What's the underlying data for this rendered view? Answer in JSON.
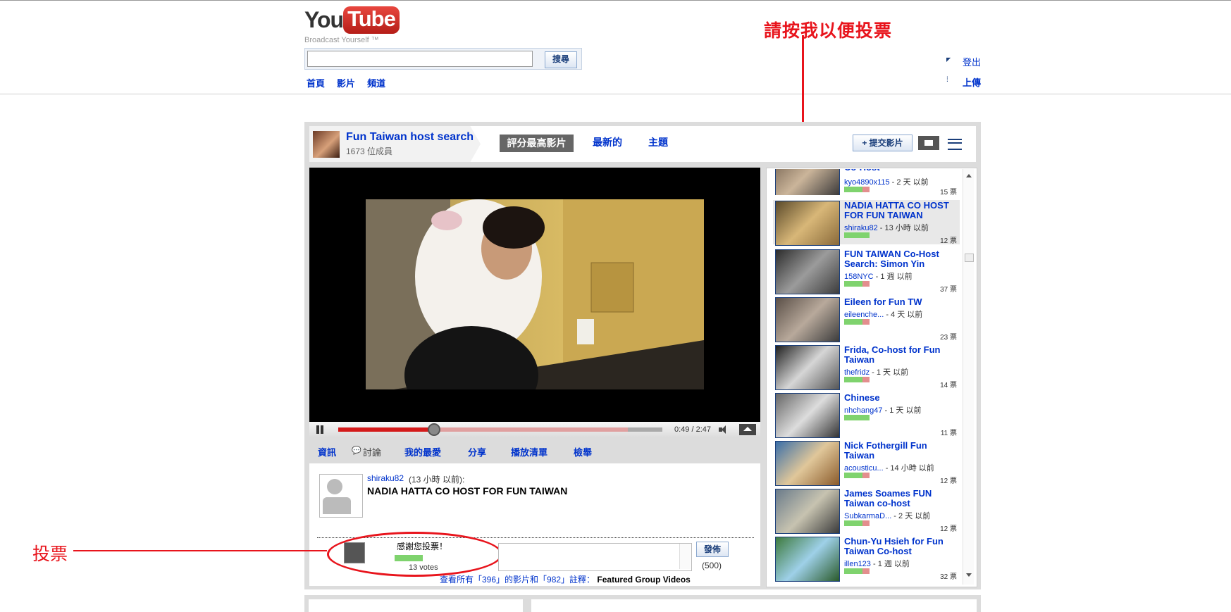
{
  "header": {
    "logo_you": "You",
    "logo_tube": "Tube",
    "tagline": "Broadcast Yourself ™",
    "search_placeholder": "",
    "search_button": "搜尋",
    "nav": [
      "首頁",
      "影片",
      "頻道"
    ],
    "signout": "登出",
    "upload": "上傳"
  },
  "annotations": {
    "vote_here": "請按我以便投票",
    "vote": "投票"
  },
  "group": {
    "title": "Fun Taiwan host search",
    "members": "1673 位成員",
    "tab_top_rated": "評分最高影片",
    "tab_newest": "最新的",
    "tab_topics": "主題",
    "submit_video": "+ 提交影片"
  },
  "player": {
    "time": "0:49 / 2:47",
    "progress_fraction": 0.293,
    "buffered_fraction": 0.894
  },
  "bottom_tabs": [
    "資訊",
    "討論",
    "我的最愛",
    "分享",
    "播放清單",
    "檢舉"
  ],
  "post": {
    "user": "shiraku82",
    "time": "(13 小時 以前):",
    "title": "NADIA HATTA CO HOST FOR FUN TAIWAN"
  },
  "vote_box": {
    "thanks": "感謝您投票！",
    "votes": "13 votes",
    "publish": "發佈",
    "char_limit": "(500)"
  },
  "view_all": {
    "text": "查看所有「396」的影片和「982」註釋：",
    "bold": "Featured Group Videos"
  },
  "sidebar_videos": [
    {
      "title": "Co-Host",
      "user": "kyo4890x115",
      "age": " - 2 天 以前",
      "votes": "15 票",
      "rating": 0.72
    },
    {
      "title": "NADIA HATTA CO HOST FOR FUN TAIWAN",
      "user": "shiraku82",
      "age": " - 13 小時 以前",
      "votes": "12 票",
      "rating": 1.0
    },
    {
      "title": "FUN TAIWAN Co-Host Search: Simon Yin",
      "user": "158NYC",
      "age": " - 1 週 以前",
      "votes": "37 票",
      "rating": 0.72
    },
    {
      "title": "Eileen for Fun TW",
      "user": "eileenche...",
      "age": " - 4 天 以前",
      "votes": "23 票",
      "rating": 0.72
    },
    {
      "title": "Frida, Co-host for Fun Taiwan",
      "user": "thefridz",
      "age": " - 1 天 以前",
      "votes": "14 票",
      "rating": 0.72
    },
    {
      "title": "Chinese",
      "user": "nhchang47",
      "age": " - 1 天 以前",
      "votes": "11 票",
      "rating": 1.0
    },
    {
      "title": "Nick Fothergill Fun Taiwan",
      "user": "acousticu...",
      "age": " - 14 小時 以前",
      "votes": "12 票",
      "rating": 0.72
    },
    {
      "title": "James Soames FUN Taiwan co-host",
      "user": "SubkarmaD...",
      "age": " - 2 天 以前",
      "votes": "12 票",
      "rating": 0.72
    },
    {
      "title": "Chun-Yu Hsieh for Fun Taiwan Co-host",
      "user": "illen123",
      "age": " - 1 週 以前",
      "votes": "32 票",
      "rating": 0.72
    }
  ],
  "colors": {
    "link": "#0033cc",
    "annotation_red": "#e8141c",
    "rating_green": "#7fd36e",
    "rating_red": "#e38e8e"
  }
}
